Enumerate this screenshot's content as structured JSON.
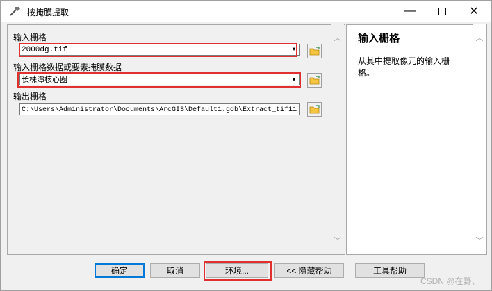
{
  "window": {
    "title": "按掩膜提取"
  },
  "fields": [
    {
      "label": "输入栅格",
      "value": "2000dg.tif"
    },
    {
      "label": "输入栅格数据或要素掩膜数据",
      "value": "长株潭核心圈"
    },
    {
      "label": "输出栅格",
      "value": "C:\\Users\\Administrator\\Documents\\ArcGIS\\Default1.gdb\\Extract_tif11"
    }
  ],
  "help": {
    "title": "输入栅格",
    "text": "从其中提取像元的输入栅格。"
  },
  "buttons": {
    "ok": "确定",
    "cancel": "取消",
    "environments": "环境...",
    "hide_help": "<< 隐藏帮助",
    "tool_help": "工具帮助"
  },
  "watermark": "CSDN @在野、",
  "colors": {
    "highlight": "#e03030",
    "default_button_border": "#0078d7"
  }
}
